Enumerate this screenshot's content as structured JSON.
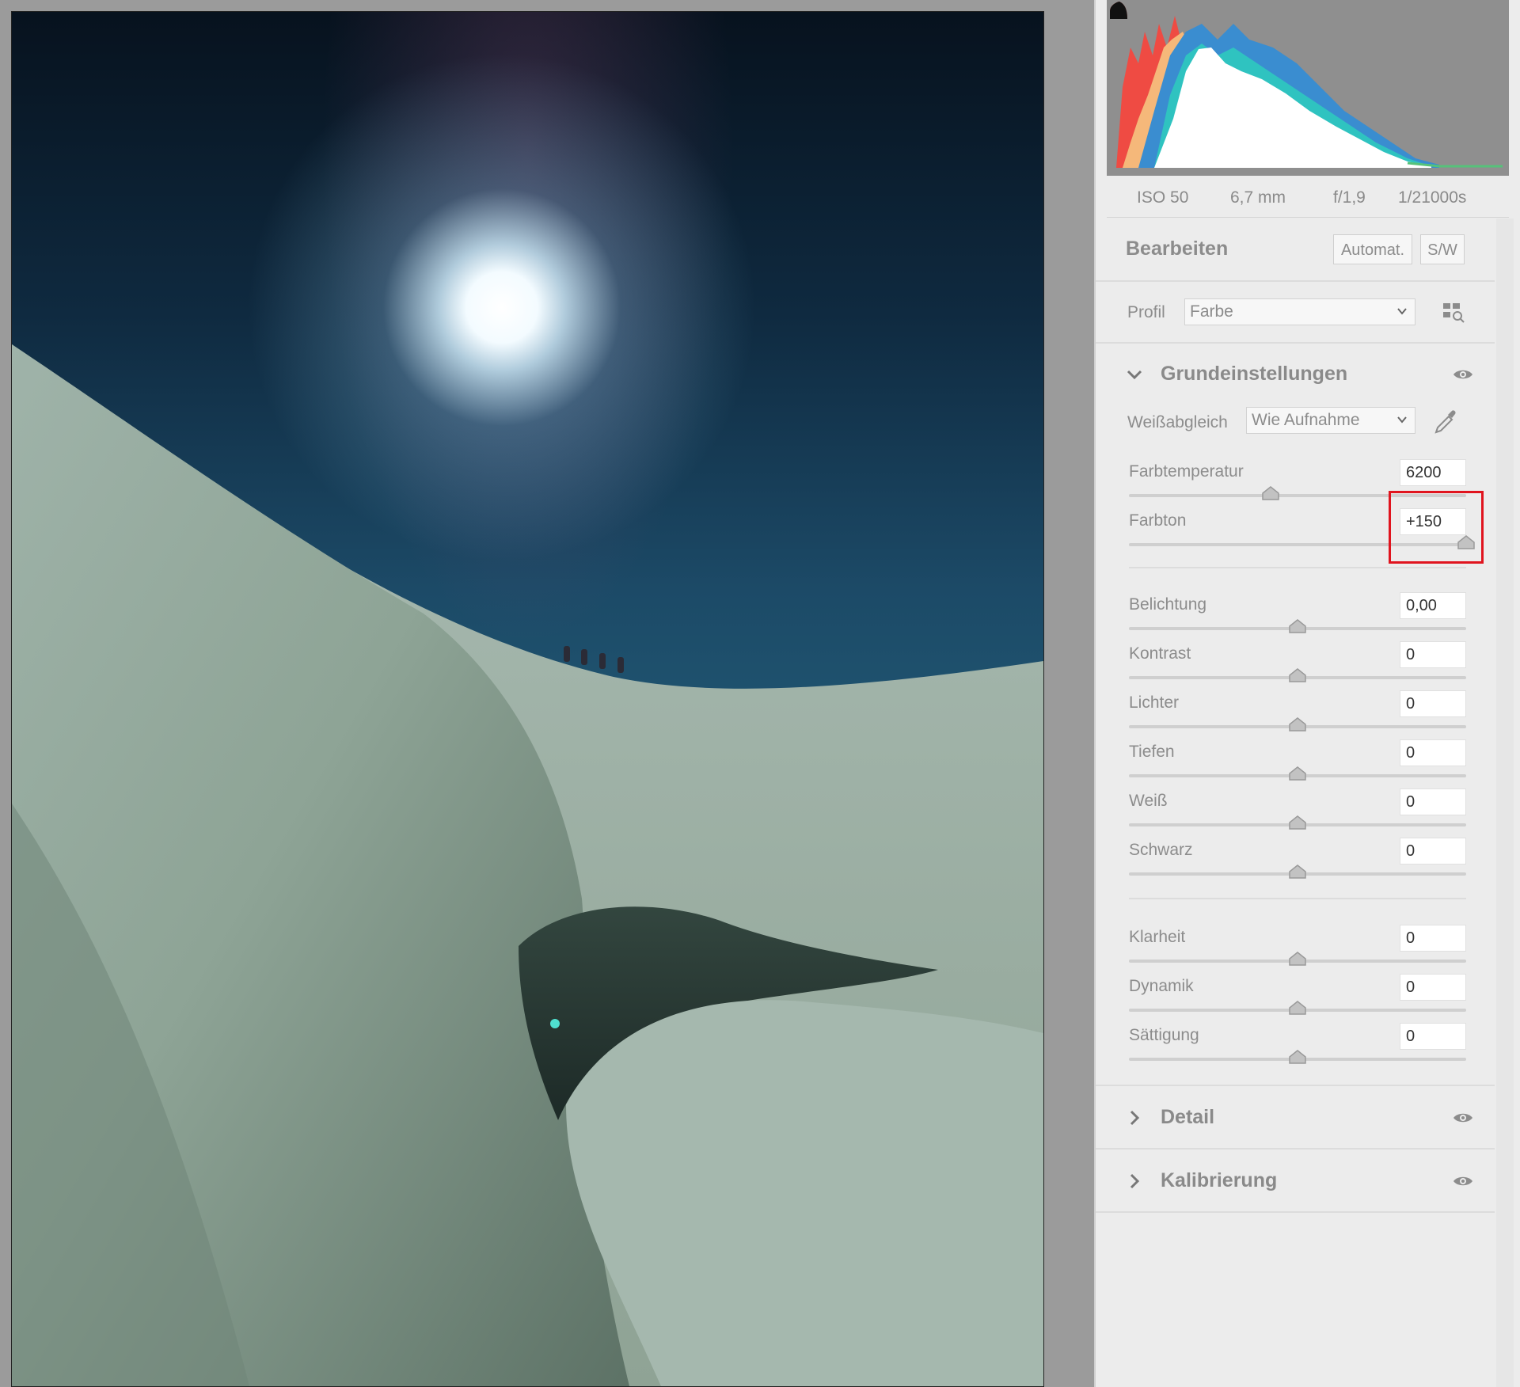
{
  "photo": {
    "description_icon": "photo-preview"
  },
  "histogram": {
    "shadow_clip_color": "#e8463c",
    "highlight_clip_color": "#111111"
  },
  "exif": {
    "iso": "ISO 50",
    "focal": "6,7 mm",
    "aperture": "f/1,9",
    "shutter": "1/21000s"
  },
  "edit": {
    "title": "Bearbeiten",
    "auto_label": "Automat.",
    "bw_label": "S/W"
  },
  "profile": {
    "label": "Profil",
    "value": "Farbe",
    "browser_icon": "grid-search-icon"
  },
  "basic": {
    "title": "Grundeinstellungen",
    "wb_label": "Weißabgleich",
    "wb_value": "Wie Aufnahme",
    "sliders": [
      {
        "label": "Farbtemperatur",
        "value": "6200",
        "level": 0.42
      },
      {
        "label": "Farbton",
        "value": "+150",
        "level": 1.0
      },
      {
        "label": "Belichtung",
        "value": "0,00",
        "level": 0.5
      },
      {
        "label": "Kontrast",
        "value": "0",
        "level": 0.5
      },
      {
        "label": "Lichter",
        "value": "0",
        "level": 0.5
      },
      {
        "label": "Tiefen",
        "value": "0",
        "level": 0.5
      },
      {
        "label": "Weiß",
        "value": "0",
        "level": 0.5
      },
      {
        "label": "Schwarz",
        "value": "0",
        "level": 0.5
      },
      {
        "label": "Klarheit",
        "value": "0",
        "level": 0.5
      },
      {
        "label": "Dynamik",
        "value": "0",
        "level": 0.5
      },
      {
        "label": "Sättigung",
        "value": "0",
        "level": 0.5
      }
    ]
  },
  "detail": {
    "title": "Detail"
  },
  "calibration": {
    "title": "Kalibrierung"
  },
  "annotation": {
    "color": "#e0141e"
  }
}
